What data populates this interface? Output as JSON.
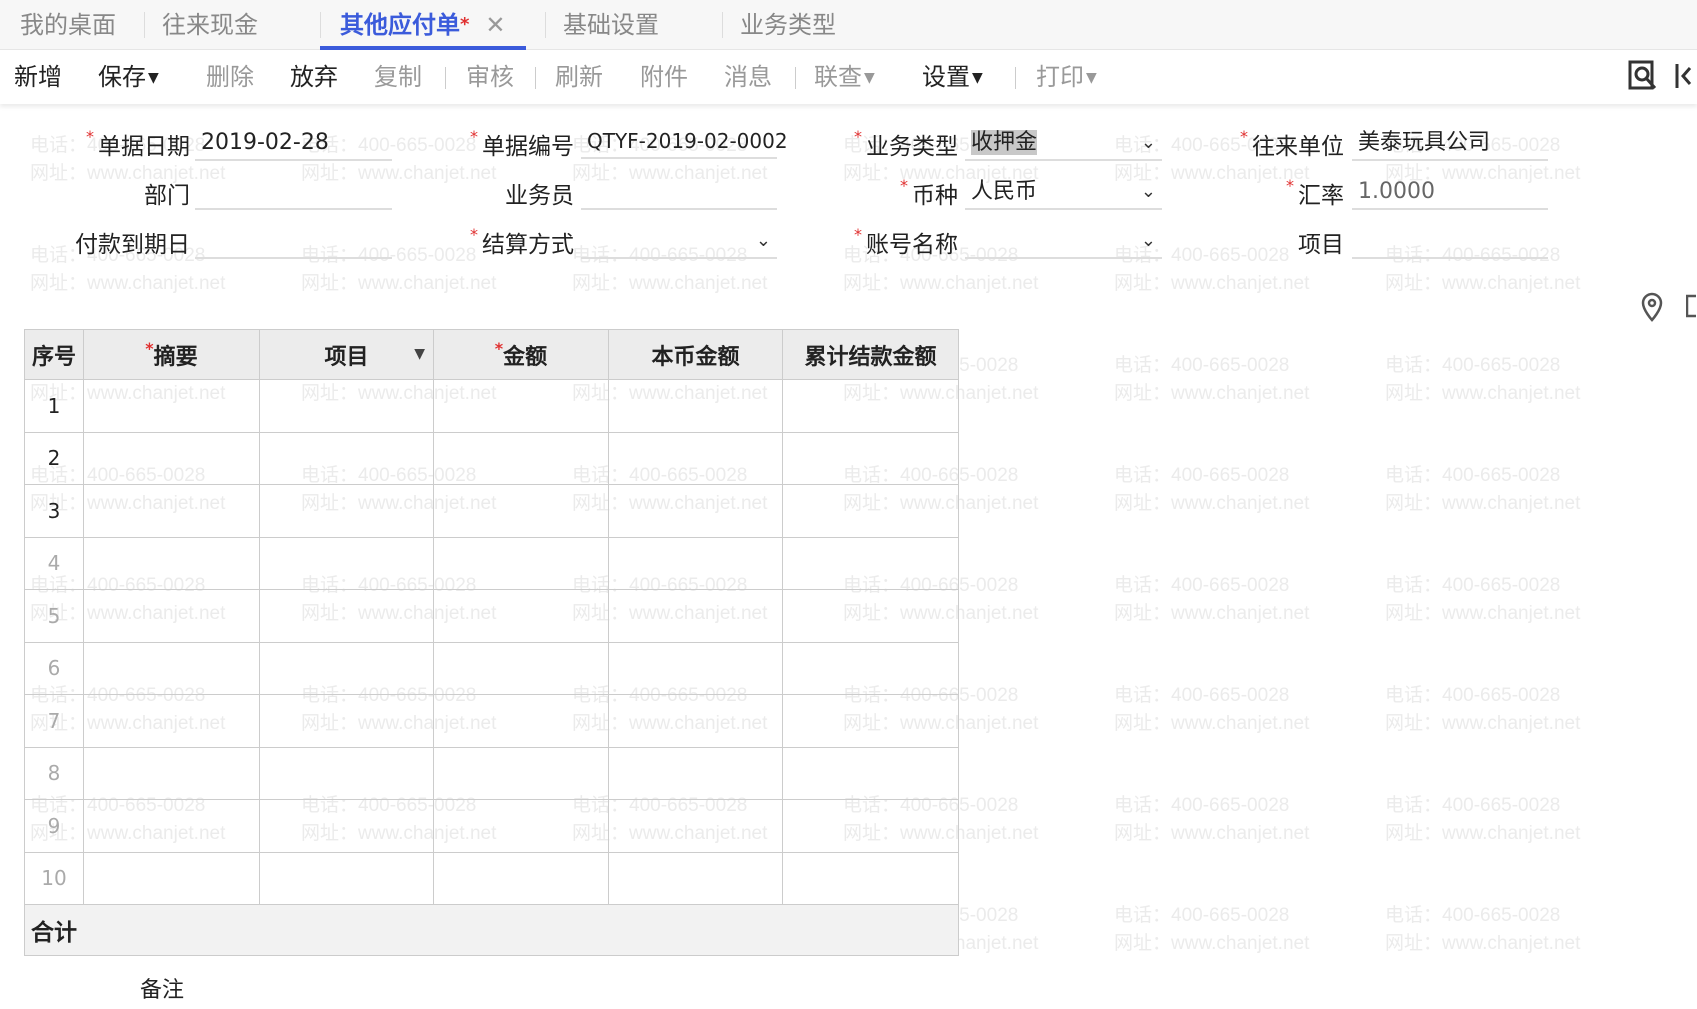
{
  "watermark": {
    "phone": "电话：400-665-0028",
    "site": "网址：www.chanjet.net"
  },
  "tabs": [
    {
      "label": "我的桌面"
    },
    {
      "label": "往来现金"
    },
    {
      "label": "其他应付单",
      "modified": "*",
      "close": "✕"
    },
    {
      "label": "基础设置"
    },
    {
      "label": "业务类型"
    }
  ],
  "toolbar": {
    "new": "新增",
    "save": "保存",
    "delete": "删除",
    "discard": "放弃",
    "copy": "复制",
    "audit": "审核",
    "refresh": "刷新",
    "attach": "附件",
    "message": "消息",
    "link": "联查",
    "settings": "设置",
    "print": "打印"
  },
  "form": {
    "doc_date": {
      "label": "单据日期",
      "value": "2019-02-28"
    },
    "doc_no": {
      "label": "单据编号",
      "value": "QTYF-2019-02-0002"
    },
    "biz_type": {
      "label": "业务类型",
      "value": "收押金"
    },
    "partner": {
      "label": "往来单位",
      "value": "美泰玩具公司"
    },
    "dept": {
      "label": "部门",
      "value": ""
    },
    "staff": {
      "label": "业务员",
      "value": ""
    },
    "currency": {
      "label": "币种",
      "value": "人民币"
    },
    "rate": {
      "label": "汇率",
      "value": "1.0000"
    },
    "due": {
      "label": "付款到期日",
      "value": ""
    },
    "settle": {
      "label": "结算方式",
      "value": ""
    },
    "account": {
      "label": "账号名称",
      "value": ""
    },
    "project": {
      "label": "项目",
      "value": ""
    }
  },
  "table": {
    "headers": [
      "序号",
      "摘要",
      "项目",
      "金额",
      "本币金额",
      "累计结款金额"
    ],
    "rows": [
      "1",
      "2",
      "3",
      "4",
      "5",
      "6",
      "7",
      "8",
      "9",
      "10"
    ],
    "total": "合计"
  },
  "remark": {
    "label": "备注"
  }
}
